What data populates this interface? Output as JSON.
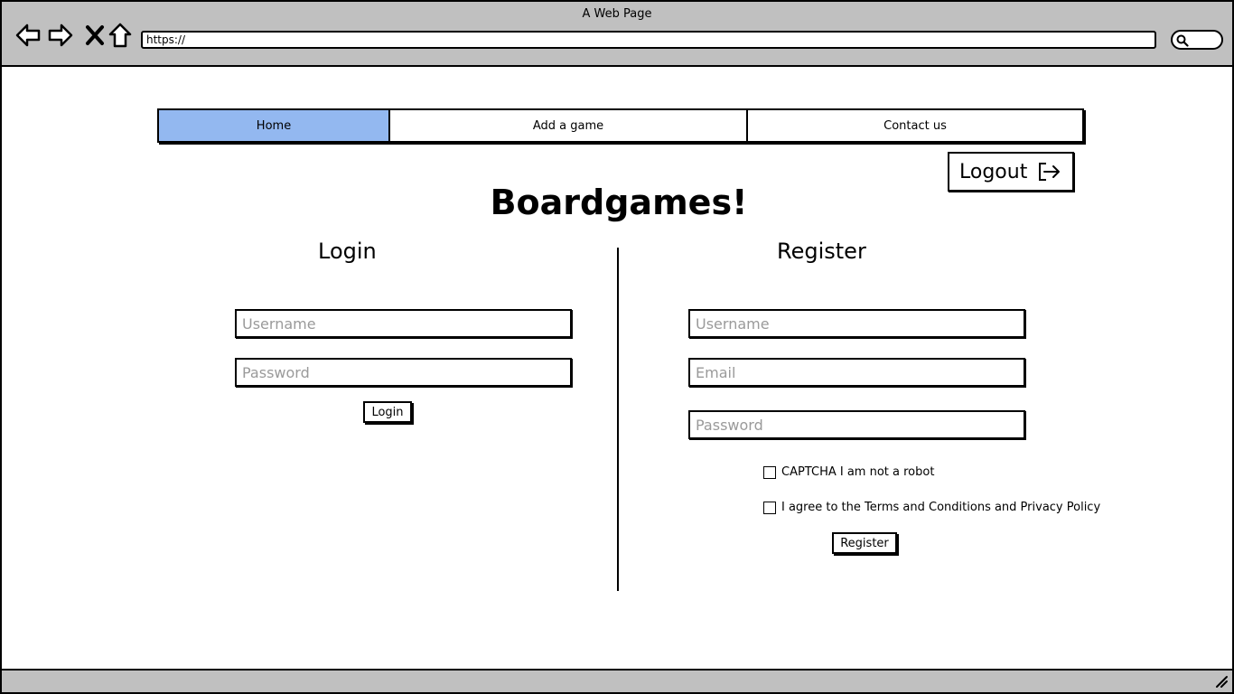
{
  "browser": {
    "window_title": "A Web Page",
    "url": "https://"
  },
  "nav": {
    "tabs": [
      {
        "label": "Home",
        "active": true
      },
      {
        "label": "Add a game",
        "active": false
      },
      {
        "label": "Contact us",
        "active": false
      }
    ]
  },
  "header": {
    "logout_label": "Logout",
    "page_title": "Boardgames!"
  },
  "login": {
    "title": "Login",
    "username_placeholder": "Username",
    "password_placeholder": "Password",
    "button_label": "Login"
  },
  "register": {
    "title": "Register",
    "username_placeholder": "Username",
    "email_placeholder": "Email",
    "password_placeholder": "Password",
    "captcha_label": "CAPTCHA I am not a robot",
    "terms_label": "I agree to the Terms and Conditions and Privacy Policy",
    "button_label": "Register"
  },
  "colors": {
    "chrome": "#c0c0c0",
    "active_tab": "#93b8f0",
    "placeholder": "#9a9a9a"
  }
}
